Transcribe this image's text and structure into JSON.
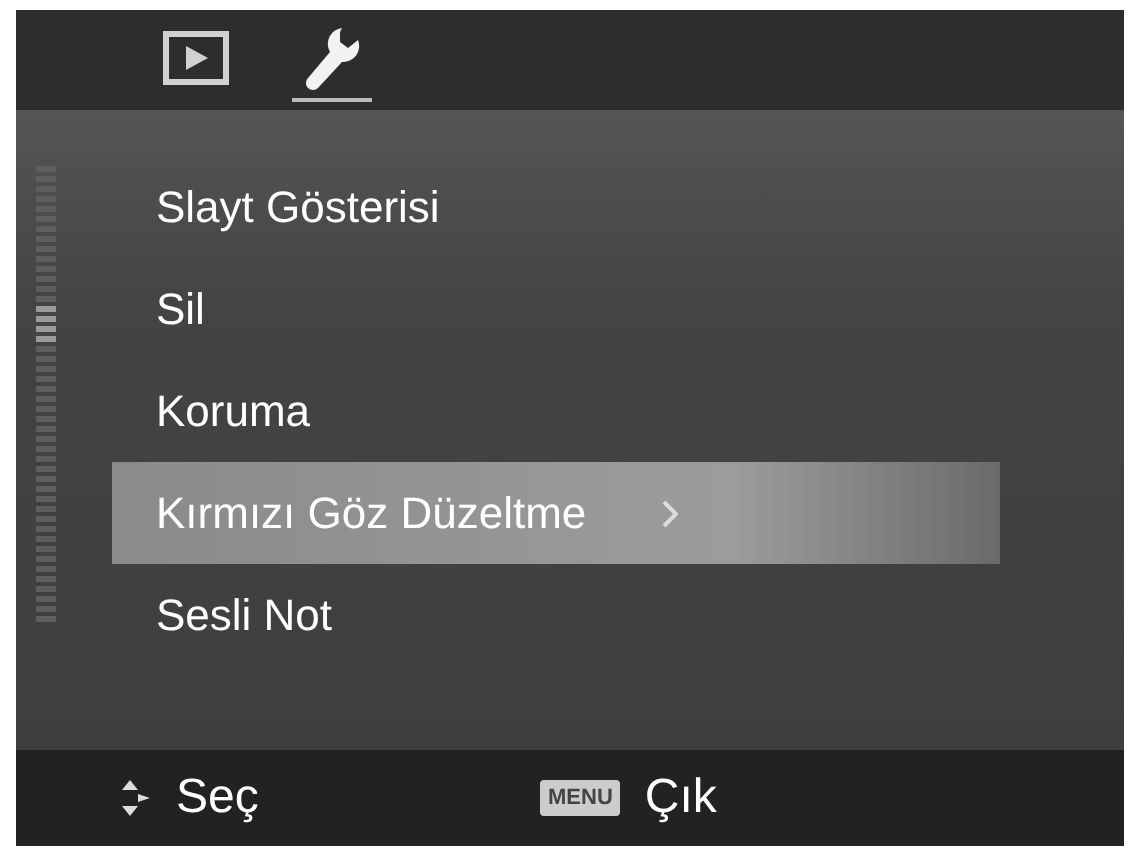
{
  "tabs": [
    {
      "kind": "playback",
      "selected": false
    },
    {
      "kind": "setup",
      "selected": true
    }
  ],
  "menu": {
    "items": [
      {
        "label": "Slayt Gösterisi",
        "selected": false
      },
      {
        "label": "Sil",
        "selected": false
      },
      {
        "label": "Koruma",
        "selected": false
      },
      {
        "label": "Kırmızı Göz Düzeltme",
        "selected": true
      },
      {
        "label": "Sesli Not",
        "selected": false
      }
    ]
  },
  "footer": {
    "select": {
      "label": "Seç"
    },
    "exit": {
      "key": "MENU",
      "label": "Çık"
    }
  }
}
